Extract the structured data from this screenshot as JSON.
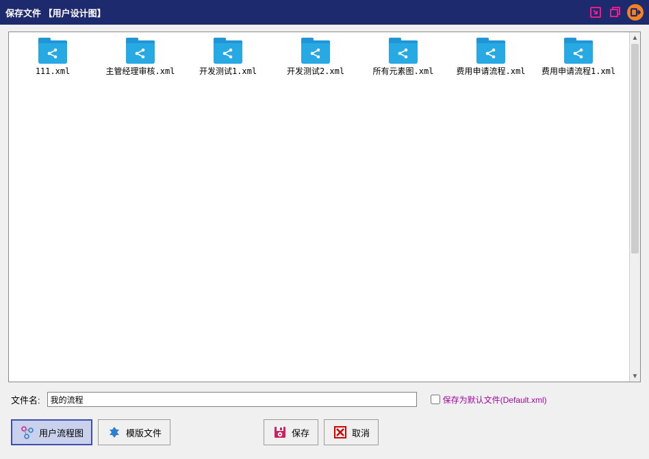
{
  "titlebar": {
    "title": "保存文件 【用户设计图】"
  },
  "files": [
    {
      "label": "111.xml"
    },
    {
      "label": "主管经理审核.xml"
    },
    {
      "label": "开发测试1.xml"
    },
    {
      "label": "开发测试2.xml"
    },
    {
      "label": "所有元素图.xml"
    },
    {
      "label": "费用申请流程.xml"
    },
    {
      "label": "费用申请流程1.xml"
    }
  ],
  "filename": {
    "label": "文件名:",
    "value": "我的流程"
  },
  "default_checkbox": {
    "label": "保存为默认文件(Default.xml)"
  },
  "buttons": {
    "user_flow": "用户流程图",
    "template": "模版文件",
    "save": "保存",
    "cancel": "取消"
  }
}
